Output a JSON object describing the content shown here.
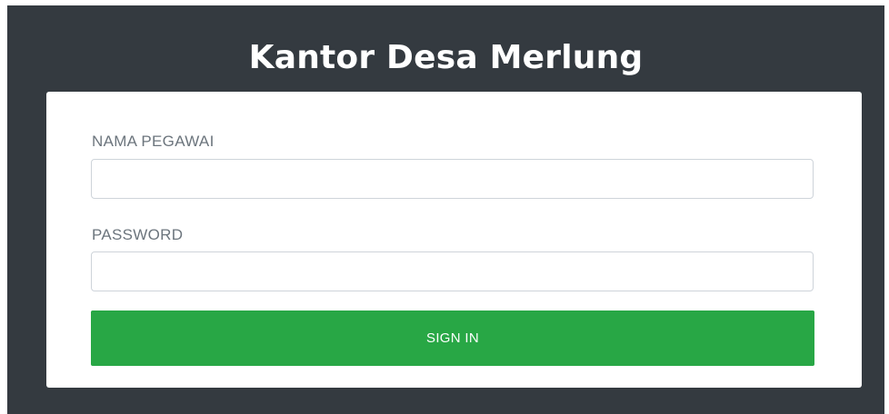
{
  "app": {
    "title": "Kantor Desa Merlung"
  },
  "login_form": {
    "username_label": "NAMA PEGAWAI",
    "username_value": "",
    "password_label": "PASSWORD",
    "password_value": "",
    "submit_label": "SIGN IN"
  },
  "colors": {
    "background": "#343a40",
    "card": "#ffffff",
    "primary_button": "#28a745",
    "label_text": "#6c757d"
  }
}
